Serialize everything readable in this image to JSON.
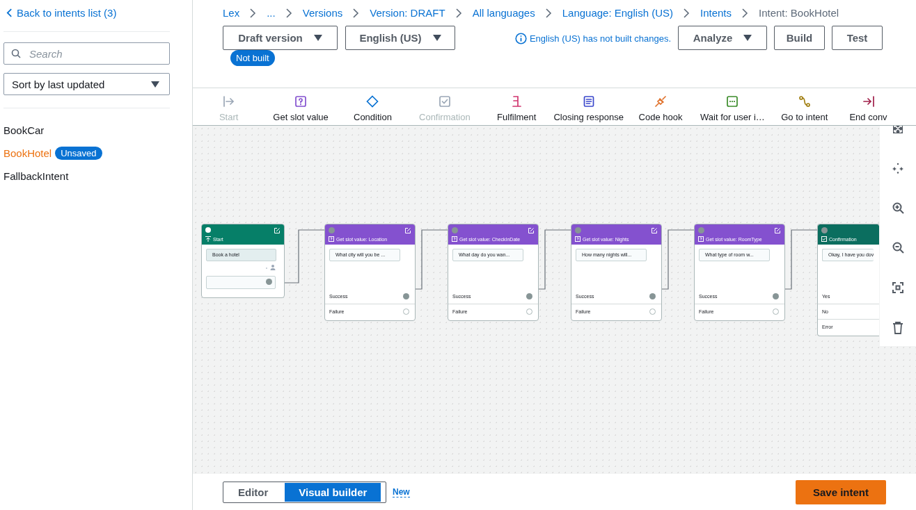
{
  "sidebar": {
    "back_link": "Back to intents list (3)",
    "search": {
      "placeholder": "Search"
    },
    "sort": {
      "value": "Sort by last updated"
    },
    "intents": [
      {
        "name": "BookCar",
        "selected": false
      },
      {
        "name": "BookHotel",
        "selected": true,
        "badge": "Unsaved"
      },
      {
        "name": "FallbackIntent",
        "selected": false
      }
    ]
  },
  "breadcrumbs": [
    {
      "label": "Lex",
      "current": false
    },
    {
      "label": "...",
      "current": false
    },
    {
      "label": "Versions",
      "current": false
    },
    {
      "label": "Version: DRAFT",
      "current": false
    },
    {
      "label": "All languages",
      "current": false
    },
    {
      "label": "Language: English (US)",
      "current": false
    },
    {
      "label": "Intents",
      "current": false
    },
    {
      "label": "Intent: BookHotel",
      "current": true
    }
  ],
  "header": {
    "version_dropdown": "Draft version",
    "language_dropdown": "English (US)",
    "status_badge": "Not built",
    "info_message": "English (US) has not built changes.",
    "analyze_button": "Analyze",
    "build_button": "Build",
    "test_button": "Test"
  },
  "palette": [
    {
      "kind": "start",
      "label": "Start",
      "disabled": true
    },
    {
      "kind": "slot",
      "label": "Get slot value",
      "disabled": false
    },
    {
      "kind": "condition",
      "label": "Condition",
      "disabled": false
    },
    {
      "kind": "confirmation",
      "label": "Confirmation",
      "disabled": true
    },
    {
      "kind": "fulfilment",
      "label": "Fulfilment",
      "disabled": false
    },
    {
      "kind": "closing",
      "label": "Closing response",
      "disabled": false
    },
    {
      "kind": "codehook",
      "label": "Code hook",
      "disabled": false
    },
    {
      "kind": "wait",
      "label": "Wait for user i…",
      "disabled": false
    },
    {
      "kind": "goto",
      "label": "Go to intent",
      "disabled": false
    },
    {
      "kind": "end",
      "label": "End conv",
      "disabled": false
    }
  ],
  "nodes": [
    {
      "kind": "start",
      "title": "Start",
      "utterance": "Book a hotel"
    },
    {
      "kind": "slot",
      "title": "Get slot value: Location",
      "prompt": "What city will you be ...",
      "branches": [
        {
          "label": "Success",
          "connected": true
        },
        {
          "label": "Failure",
          "connected": false
        }
      ]
    },
    {
      "kind": "slot",
      "title": "Get slot value: CheckInDate",
      "prompt": "What day do you wan...",
      "branches": [
        {
          "label": "Success",
          "connected": true
        },
        {
          "label": "Failure",
          "connected": false
        }
      ]
    },
    {
      "kind": "slot",
      "title": "Get slot value: Nights",
      "prompt": "How many nights will...",
      "branches": [
        {
          "label": "Success",
          "connected": true
        },
        {
          "label": "Failure",
          "connected": false
        }
      ]
    },
    {
      "kind": "slot",
      "title": "Get slot value: RoomType",
      "prompt": "What type of room w...",
      "branches": [
        {
          "label": "Success",
          "connected": true
        },
        {
          "label": "Failure",
          "connected": false
        }
      ]
    },
    {
      "kind": "confirmation",
      "title": "Confirmation",
      "prompt": "Okay, I have you dov",
      "branches": [
        {
          "label": "Yes"
        },
        {
          "label": "No"
        },
        {
          "label": "Error"
        }
      ]
    }
  ],
  "footer": {
    "modes": [
      {
        "label": "Editor",
        "selected": false
      },
      {
        "label": "Visual builder",
        "selected": true
      }
    ],
    "new_link": "New",
    "save_button": "Save intent"
  }
}
